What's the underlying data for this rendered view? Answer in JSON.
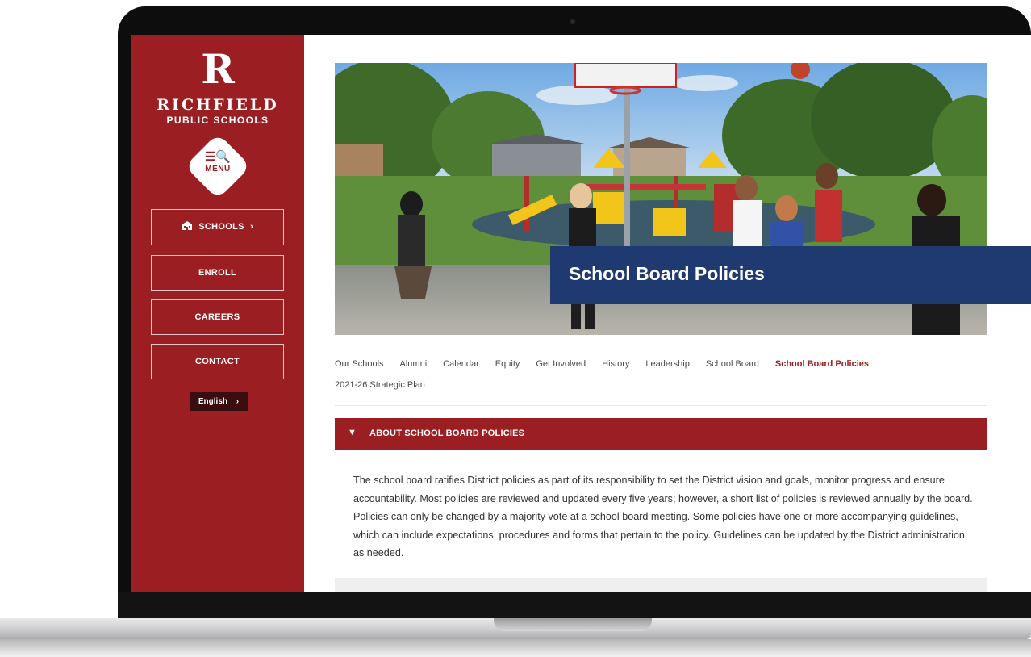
{
  "sidebar": {
    "logo_letter": "R",
    "logo_name": "RICHFIELD",
    "logo_sub": "PUBLIC SCHOOLS",
    "menu_icon": "☰🔍",
    "menu_label": "MENU",
    "schools_label": "SCHOOLS",
    "enroll_label": "ENROLL",
    "careers_label": "CAREERS",
    "contact_label": "CONTACT",
    "language": "English"
  },
  "hero": {
    "title": "School Board Policies"
  },
  "subnav": {
    "items": [
      "Our Schools",
      "Alumni",
      "Calendar",
      "Equity",
      "Get Involved",
      "History",
      "Leadership",
      "School Board",
      "School Board Policies",
      "2021-26 Strategic Plan"
    ]
  },
  "accordion": {
    "label": "ABOUT SCHOOL BOARD POLICIES",
    "body": "The school board ratifies District policies as part of its responsibility to set the District vision and goals, monitor progress and ensure accountability. Most policies are reviewed and updated every five years; however, a short list of policies is reviewed annually by the board. Policies can only be changed by a majority vote at a school board meeting. Some policies have one or more accompanying guidelines, which can include expectations, procedures and forms that pertain to the policy. Guidelines can be updated by the District administration as needed."
  },
  "colors": {
    "brand_red": "#9b1f22",
    "title_blue": "#1f3a70"
  }
}
